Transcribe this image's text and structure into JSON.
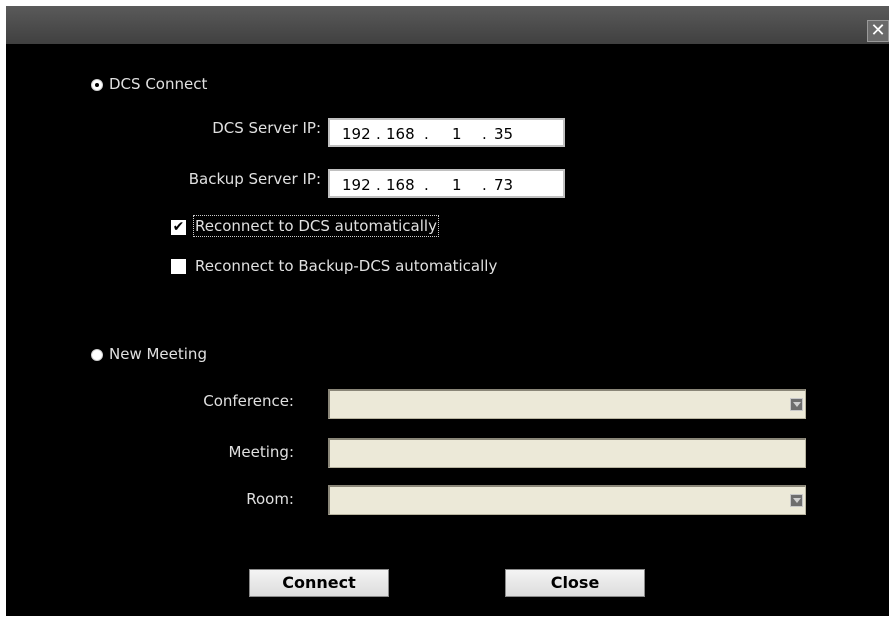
{
  "window": {
    "close_glyph": "✕"
  },
  "dcs_connect": {
    "label": "DCS Connect",
    "selected": true,
    "server_ip_label": "DCS Server IP:",
    "server_ip": [
      "192",
      "168",
      "1",
      "35"
    ],
    "backup_ip_label": "Backup Server IP:",
    "backup_ip": [
      "192",
      "168",
      "1",
      "73"
    ],
    "reconnect_dcs": {
      "label": "Reconnect to DCS automatically",
      "checked": true
    },
    "reconnect_backup": {
      "label": "Reconnect to Backup-DCS automatically",
      "checked": false
    }
  },
  "new_meeting": {
    "label": "New Meeting",
    "selected": false,
    "conference_label": "Conference:",
    "conference_value": "",
    "meeting_label": "Meeting:",
    "meeting_value": "",
    "room_label": "Room:",
    "room_value": ""
  },
  "buttons": {
    "connect": "Connect",
    "close": "Close"
  },
  "ip_separator": ".",
  "check_glyph": "✔",
  "colors": {
    "background": "#000000",
    "titlebar": "#4a4a4a",
    "text": "#e0e0e0",
    "field_fill": "#ece9d8"
  },
  "icons": {
    "close": "close-icon",
    "dropdown": "chevron-down-icon"
  }
}
